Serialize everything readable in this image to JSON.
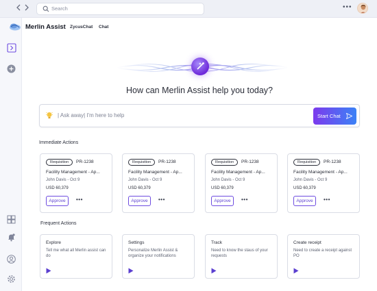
{
  "topbar": {
    "search_placeholder": "Search",
    "more_label": "•••"
  },
  "header": {
    "brand": "Merlin Assist",
    "links": [
      "ZycusChat",
      "Chat"
    ]
  },
  "hero": {
    "title": "How can Merlin Assist help you today?",
    "prompt_placeholder": "| Ask away| I'm here to help",
    "start_chat_label": "Start Chat"
  },
  "immediate": {
    "title": "Immediate Actions",
    "cards": [
      {
        "badge": "Requisition",
        "id": "PR-1238",
        "title": "Facility Management - Ap...",
        "meta": "John Davis - Oct 9",
        "amount": "USD 60,379",
        "approve": "Approve",
        "more": "•••"
      },
      {
        "badge": "Requisition",
        "id": "PR-1238",
        "title": "Facility Management - Ap...",
        "meta": "John Davis - Oct 9",
        "amount": "USD 60,379",
        "approve": "Approve",
        "more": "•••"
      },
      {
        "badge": "Requisition",
        "id": "PR-1238",
        "title": "Facility Management - Ap...",
        "meta": "John Davis - Oct 9",
        "amount": "USD 60,379",
        "approve": "Approve",
        "more": "•••"
      },
      {
        "badge": "Requisition",
        "id": "PR-1238",
        "title": "Facility Management - Ap...",
        "meta": "John Davis - Oct 9",
        "amount": "USD 60,379",
        "approve": "Approve",
        "more": "•••"
      }
    ]
  },
  "frequent": {
    "title": "Frequent Actions",
    "cards": [
      {
        "title": "Explore",
        "desc": "Tell me what all Merlin assist can do"
      },
      {
        "title": "Settings",
        "desc": "Personalize Merlin Assist & organize your notifications"
      },
      {
        "title": "Track",
        "desc": "Need to know the staus of your requests"
      },
      {
        "title": "Create receipt",
        "desc": "Need to create a receipt against PO"
      }
    ]
  },
  "colors": {
    "accent": "#6d4be0",
    "gradient_start": "#7c3aed",
    "gradient_end": "#3b82f6"
  }
}
